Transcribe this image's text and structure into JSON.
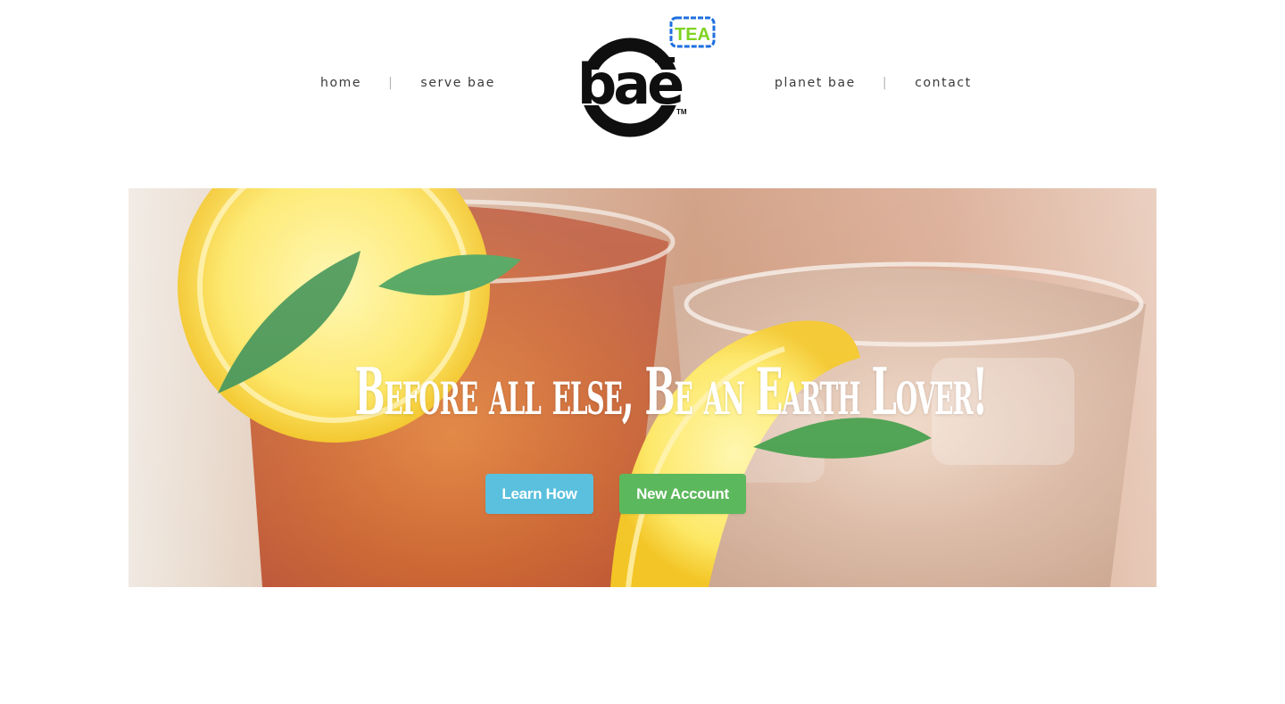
{
  "nav": {
    "left": [
      {
        "label": "home"
      },
      {
        "label": "serve bae"
      }
    ],
    "right": [
      {
        "label": "planet bae"
      },
      {
        "label": "contact"
      }
    ],
    "separator": "|"
  },
  "logo": {
    "wordmark": "bae",
    "badge": "TEA",
    "trademark": "TM",
    "badge_color": "#7ed321",
    "badge_border_color": "#1f6fe0"
  },
  "hero": {
    "headline": "Before all else, Be an Earth Lover!",
    "buttons": {
      "learn_how": "Learn How",
      "new_account": "New Account"
    },
    "colors": {
      "learn_how": "#5bc0de",
      "new_account": "#5cb85c"
    }
  }
}
